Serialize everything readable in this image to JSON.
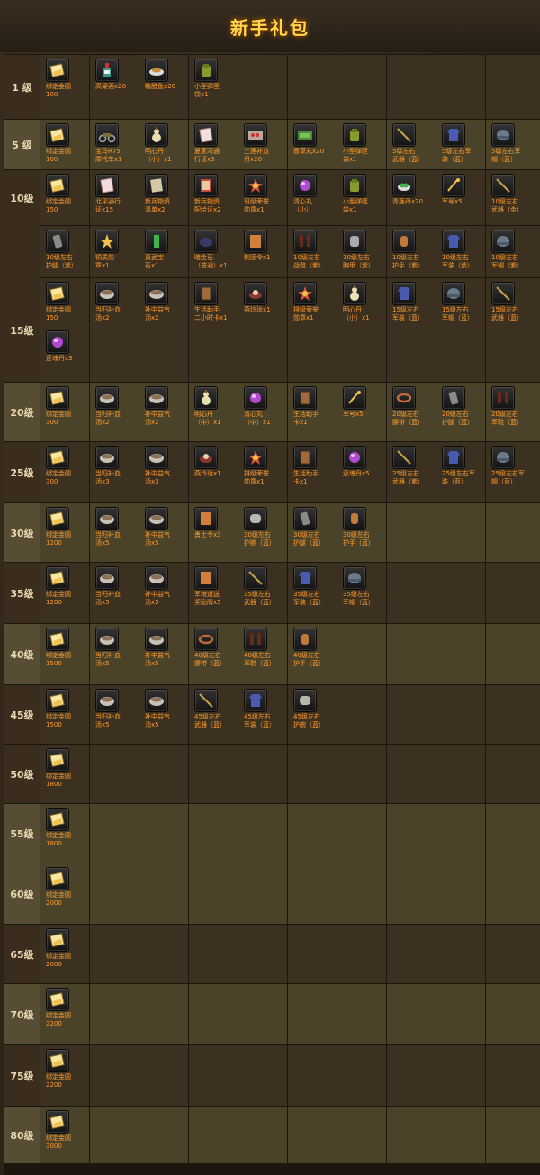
{
  "header": {
    "title": "新手礼包"
  },
  "colors": {
    "label": "#ff9a2c",
    "gold": "#f3c14a",
    "brown": "#9a8066",
    "green": "#3fb24a",
    "purple": "#b04ad0",
    "red": "#d04a3c",
    "blue": "#3a78d0",
    "grey": "#8a8a86"
  },
  "rows": [
    {
      "level": "1 级",
      "items": [
        {
          "label": "绑定金圆\n100",
          "icon": "gold-ingot-icon"
        },
        {
          "label": "高粱酒x20",
          "icon": "liquor-bottle-icon"
        },
        {
          "label": "糖醋鱼x20",
          "icon": "fish-dish-icon"
        },
        {
          "label": "小型弹匣\n袋x1",
          "icon": "ammo-pouch-icon"
        }
      ]
    },
    {
      "level": "5 级",
      "items": [
        {
          "label": "绑定金圆\n100",
          "icon": "gold-ingot-icon"
        },
        {
          "label": "宝马R75\n摩托车x1",
          "icon": "motorcycle-icon"
        },
        {
          "label": "明心丹\n（小）x1",
          "icon": "gourd-icon"
        },
        {
          "label": "夏家湾通\n行证x3",
          "icon": "pass-card-icon"
        },
        {
          "label": "土莲补血\n丹x20",
          "icon": "pill-box-icon"
        },
        {
          "label": "香草丸x20",
          "icon": "herb-pill-icon"
        },
        {
          "label": "小型弹匣\n袋x1",
          "icon": "ammo-pouch-icon"
        },
        {
          "label": "5级左右\n武器（蓝）",
          "icon": "rifle-icon"
        },
        {
          "label": "5级左右军\n装（蓝）",
          "icon": "uniform-icon"
        },
        {
          "label": "5级左右军\n帽（蓝）",
          "icon": "helmet-icon"
        }
      ]
    },
    {
      "level": "10级",
      "items": [
        {
          "label": "绑定金圆\n150",
          "icon": "gold-ingot-icon"
        },
        {
          "label": "北平通行\n证x15",
          "icon": "pass-card-icon"
        },
        {
          "label": "新兵物资\n清单x2",
          "icon": "scroll-icon"
        },
        {
          "label": "新兵物资\n配给证x2",
          "icon": "certificate-icon"
        },
        {
          "label": "班级荣誉\n勋章x1",
          "icon": "medal-icon"
        },
        {
          "label": "清心丸\n（小）",
          "icon": "purple-orb-icon"
        },
        {
          "label": "小型弹匣\n袋x1",
          "icon": "ammo-pouch-icon"
        },
        {
          "label": "青莲丹x20",
          "icon": "green-pill-icon"
        },
        {
          "label": "军号x5",
          "icon": "bugle-icon"
        },
        {
          "label": "10级左右\n武器（金）",
          "icon": "rifle-icon"
        }
      ]
    },
    {
      "level": "",
      "items": [
        {
          "label": "10级左右\n护腿（紫）",
          "icon": "leg-guard-icon"
        },
        {
          "label": "铜质勋\n章x1",
          "icon": "star-medal-icon"
        },
        {
          "label": "真武宝\n石x1",
          "icon": "green-gem-icon"
        },
        {
          "label": "暗金石\n（普通）x1",
          "icon": "dark-stone-icon"
        },
        {
          "label": "剿匪令x1",
          "icon": "token-icon"
        },
        {
          "label": "10级左右\n战鞋（紫）",
          "icon": "boots-icon"
        },
        {
          "label": "10级左右\n胸甲（紫）",
          "icon": "armor-icon"
        },
        {
          "label": "10级左右\n护手（紫）",
          "icon": "gloves-icon"
        },
        {
          "label": "10级左右\n军装（紫）",
          "icon": "uniform-icon"
        },
        {
          "label": "10级左右\n军帽（紫）",
          "icon": "helmet-icon"
        }
      ]
    },
    {
      "level": "15级",
      "items": [
        {
          "label": "绑定金圆\n150",
          "icon": "gold-ingot-icon"
        },
        {
          "label": "当归补血\n汤x2",
          "icon": "soup-bowl-icon"
        },
        {
          "label": "补中益气\n汤x2",
          "icon": "soup-bowl-icon"
        },
        {
          "label": "生活助手\n二小时卡x1",
          "icon": "book-icon"
        },
        {
          "label": "燕玲珑x1",
          "icon": "bird-nest-icon"
        },
        {
          "label": "排级荣誉\n勋章x1",
          "icon": "medal-icon"
        },
        {
          "label": "明心丹\n（小）x1",
          "icon": "gourd-icon"
        },
        {
          "label": "15级左右\n军装（蓝）",
          "icon": "uniform-icon"
        },
        {
          "label": "15级左右\n军帽（蓝）",
          "icon": "helmet-icon"
        },
        {
          "label": "15级左右\n武器（蓝）",
          "icon": "rifle-icon"
        },
        {
          "label": "还魂丹x3",
          "icon": "purple-orb-icon"
        }
      ]
    },
    {
      "level": "20级",
      "items": [
        {
          "label": "绑定金圆\n300",
          "icon": "gold-ingot-icon"
        },
        {
          "label": "当归补血\n汤x2",
          "icon": "soup-bowl-icon"
        },
        {
          "label": "补中益气\n汤x2",
          "icon": "soup-bowl-icon"
        },
        {
          "label": "明心丹\n（中）x1",
          "icon": "gourd-icon"
        },
        {
          "label": "清心丸\n（中）x1",
          "icon": "purple-orb-icon"
        },
        {
          "label": "生活助手\n卡x1",
          "icon": "book-icon"
        },
        {
          "label": "军号x5",
          "icon": "bugle-icon"
        },
        {
          "label": "20级左右\n腰带（蓝）",
          "icon": "belt-icon"
        },
        {
          "label": "20级左右\n护腿（蓝）",
          "icon": "leg-guard-icon"
        },
        {
          "label": "20级左右\n军鞋（蓝）",
          "icon": "boots-icon"
        }
      ]
    },
    {
      "level": "25级",
      "items": [
        {
          "label": "绑定金圆\n300",
          "icon": "gold-ingot-icon"
        },
        {
          "label": "当归补血\n汤x3",
          "icon": "soup-bowl-icon"
        },
        {
          "label": "补中益气\n汤x3",
          "icon": "soup-bowl-icon"
        },
        {
          "label": "燕玲珑x1",
          "icon": "bird-nest-icon"
        },
        {
          "label": "排级荣誉\n勋章x1",
          "icon": "medal-icon"
        },
        {
          "label": "生活助手\n卡x1",
          "icon": "book-icon"
        },
        {
          "label": "还魂丹x5",
          "icon": "purple-orb-icon"
        },
        {
          "label": "25级左右\n武器（紫）",
          "icon": "rifle-icon"
        },
        {
          "label": "25级左右军\n装（蓝）",
          "icon": "uniform-icon"
        },
        {
          "label": "25级左右军\n帽（蓝）",
          "icon": "helmet-icon"
        }
      ]
    },
    {
      "level": "30级",
      "items": [
        {
          "label": "绑定金圆\n1200",
          "icon": "gold-ingot-icon"
        },
        {
          "label": "当归补血\n汤x5",
          "icon": "soup-bowl-icon"
        },
        {
          "label": "补中益气\n汤x5",
          "icon": "soup-bowl-icon"
        },
        {
          "label": "勇士令x3",
          "icon": "token-icon"
        },
        {
          "label": "30级左右\n护腕（蓝）",
          "icon": "bracer-icon"
        },
        {
          "label": "30级左右\n护腿（蓝）",
          "icon": "leg-guard-icon"
        },
        {
          "label": "30级左右\n护手（蓝）",
          "icon": "gloves-icon"
        }
      ]
    },
    {
      "level": "35级",
      "items": [
        {
          "label": "绑定金圆\n1200",
          "icon": "gold-ingot-icon"
        },
        {
          "label": "当归补血\n汤x5",
          "icon": "soup-bowl-icon"
        },
        {
          "label": "补中益气\n汤x5",
          "icon": "soup-bowl-icon"
        },
        {
          "label": "军粮运送\n奖励牌x5",
          "icon": "token-icon"
        },
        {
          "label": "35级左右\n武器（蓝）",
          "icon": "rifle-icon"
        },
        {
          "label": "35级左右\n军装（蓝）",
          "icon": "uniform-icon"
        },
        {
          "label": "35级左右\n军帽（蓝）",
          "icon": "helmet-icon"
        }
      ]
    },
    {
      "level": "40级",
      "items": [
        {
          "label": "绑定金圆\n1500",
          "icon": "gold-ingot-icon"
        },
        {
          "label": "当归补血\n汤x5",
          "icon": "soup-bowl-icon"
        },
        {
          "label": "补中益气\n汤x5",
          "icon": "soup-bowl-icon"
        },
        {
          "label": "40级左右\n腰带（蓝）",
          "icon": "belt-icon"
        },
        {
          "label": "40级左右\n军鞋（蓝）",
          "icon": "boots-icon"
        },
        {
          "label": "40级左右\n护手（蓝）",
          "icon": "gloves-icon"
        }
      ]
    },
    {
      "level": "45级",
      "items": [
        {
          "label": "绑定金圆\n1500",
          "icon": "gold-ingot-icon"
        },
        {
          "label": "当归补血\n汤x5",
          "icon": "soup-bowl-icon"
        },
        {
          "label": "补中益气\n汤x5",
          "icon": "soup-bowl-icon"
        },
        {
          "label": "45级左右\n武器（蓝）",
          "icon": "rifle-icon"
        },
        {
          "label": "45级左右\n军装（蓝）",
          "icon": "uniform-icon"
        },
        {
          "label": "45级左右\n护腕（蓝）",
          "icon": "bracer-icon"
        }
      ]
    },
    {
      "level": "50级",
      "items": [
        {
          "label": "绑定金圆\n1800",
          "icon": "gold-ingot-icon"
        }
      ]
    },
    {
      "level": "55级",
      "items": [
        {
          "label": "绑定金圆\n1800",
          "icon": "gold-ingot-icon"
        }
      ]
    },
    {
      "level": "60级",
      "items": [
        {
          "label": "绑定金圆\n2000",
          "icon": "gold-ingot-icon"
        }
      ]
    },
    {
      "level": "65级",
      "items": [
        {
          "label": "绑定金圆\n2000",
          "icon": "gold-ingot-icon"
        }
      ]
    },
    {
      "level": "70级",
      "items": [
        {
          "label": "绑定金圆\n2200",
          "icon": "gold-ingot-icon"
        }
      ]
    },
    {
      "level": "75级",
      "items": [
        {
          "label": "绑定金圆\n2200",
          "icon": "gold-ingot-icon"
        }
      ]
    },
    {
      "level": "80级",
      "items": [
        {
          "label": "绑定金圆\n3000",
          "icon": "gold-ingot-icon"
        }
      ]
    }
  ]
}
